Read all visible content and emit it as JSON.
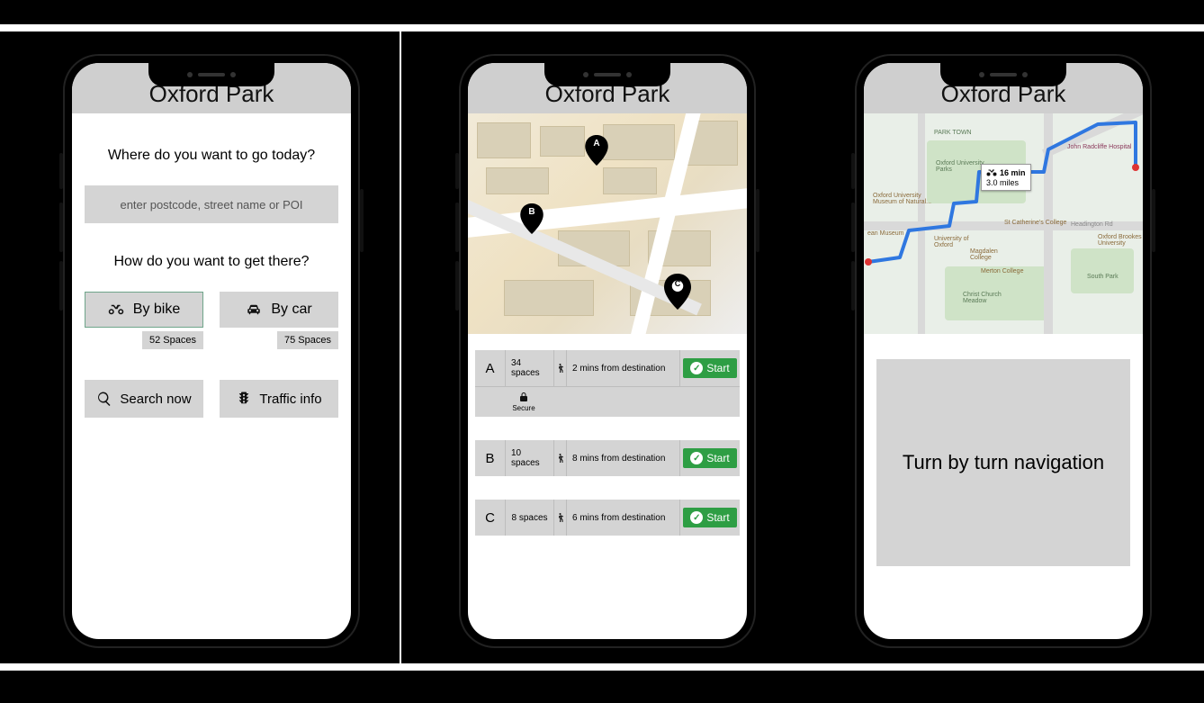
{
  "app_title": "Oxford Park",
  "screen1": {
    "prompt_dest": "Where do you want to go today?",
    "input_placeholder": "enter postcode, street name or POI",
    "prompt_mode": "How do you want to get there?",
    "mode_bike": {
      "label": "By bike",
      "spaces": "52 Spaces",
      "selected": true
    },
    "mode_car": {
      "label": "By car",
      "spaces": "75 Spaces",
      "selected": false
    },
    "search_btn": "Search now",
    "traffic_btn": "Traffic info"
  },
  "screen2": {
    "pins": [
      "A",
      "B",
      "C"
    ],
    "results": [
      {
        "id": "A",
        "spaces": "34 spaces",
        "dist": "2 mins from destination",
        "start": "Start",
        "secure_label": "Secure",
        "secure": true
      },
      {
        "id": "B",
        "spaces": "10 spaces",
        "dist": "8 mins from destination",
        "start": "Start",
        "secure": false
      },
      {
        "id": "C",
        "spaces": "8 spaces",
        "dist": "6 mins from destination",
        "start": "Start",
        "secure": false
      }
    ]
  },
  "screen3": {
    "route_time": "16 min",
    "route_dist": "3.0 miles",
    "labels": {
      "park_town": "PARK TOWN",
      "ou_parks": "Oxford University Parks",
      "ou_museum": "Oxford University Museum of Natural...",
      "ean": "ean Museum",
      "uni": "University of Oxford",
      "radcliffe": "John Radcliffe Hospital",
      "magdalen": "Magdalen College",
      "st_cath": "St Catherine's College",
      "merton": "Merton College",
      "christ": "Christ Church Meadow",
      "brookes": "Oxford Brookes University",
      "headington": "Headington Rd",
      "south_park": "South Park"
    },
    "nav_text": "Turn by turn navigation"
  }
}
